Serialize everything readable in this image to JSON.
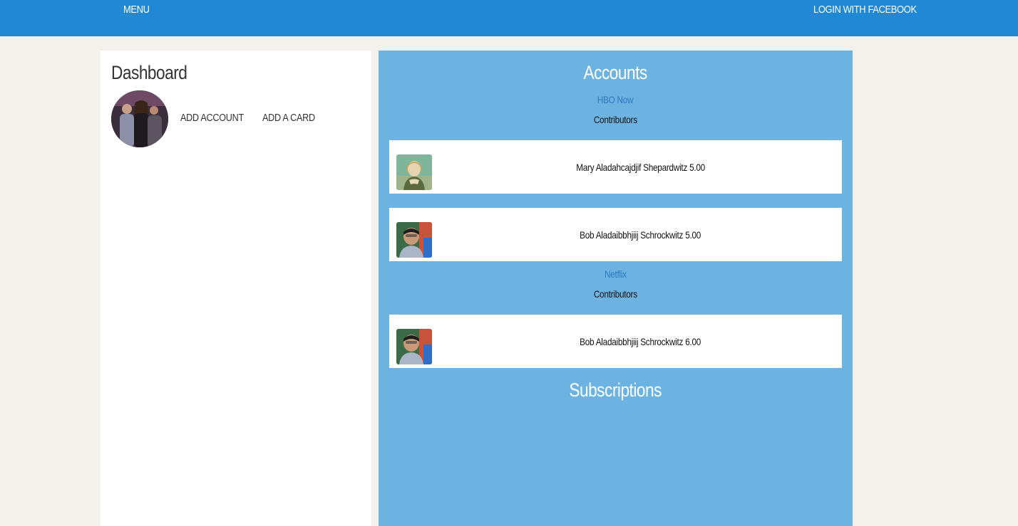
{
  "header": {
    "menu_label": "MENU",
    "login_label": "LOGIN WITH FACEBOOK"
  },
  "dashboard": {
    "title": "Dashboard",
    "add_account_label": "ADD ACCOUNT",
    "add_card_label": "ADD A CARD"
  },
  "accounts": {
    "heading": "Accounts",
    "items": [
      {
        "name": "HBO Now",
        "contributors_label": "Contributors",
        "contributors": [
          {
            "text": "Mary Aladahcajdjif Shepardwitz 5.00"
          },
          {
            "text": "Bob Aladaibbhjiij Schrockwitz 5.00"
          }
        ]
      },
      {
        "name": "Netflix",
        "contributors_label": "Contributors",
        "contributors": [
          {
            "text": "Bob Aladaibbhjiij Schrockwitz 6.00"
          }
        ]
      }
    ]
  },
  "subscriptions": {
    "heading": "Subscriptions"
  },
  "colors": {
    "header_bg": "#2088d4",
    "page_bg": "#f4f1ec",
    "accounts_panel_bg": "#6db3e2",
    "account_link": "#2a78c0"
  }
}
